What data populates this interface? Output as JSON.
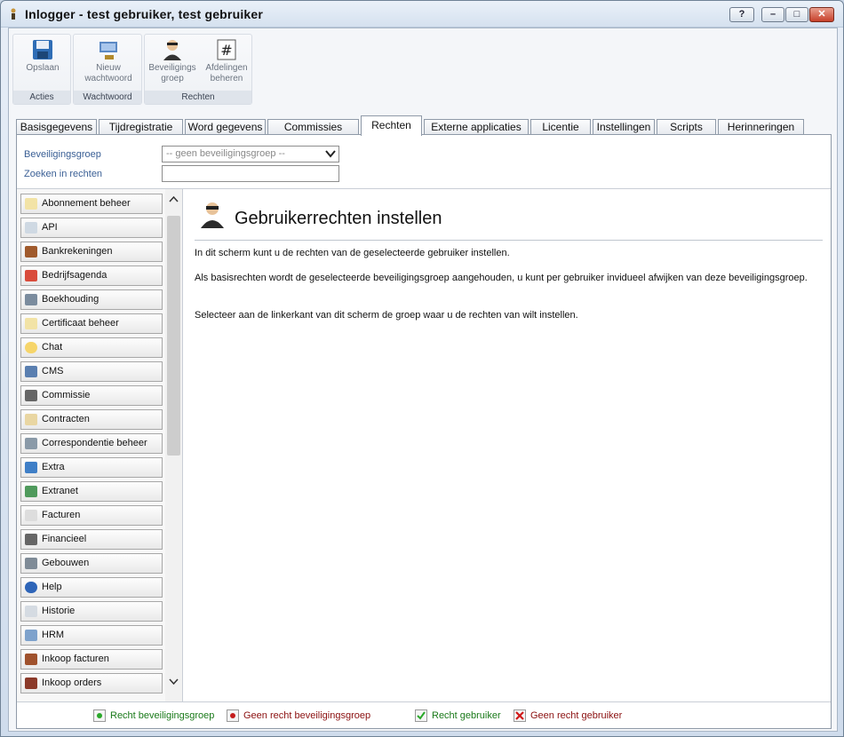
{
  "window": {
    "title": "Inlogger - test gebruiker, test gebruiker",
    "help": "?",
    "min": "–",
    "max": "□",
    "close": "✕"
  },
  "ribbon": {
    "groups": [
      {
        "label": "Acties",
        "buttons": [
          {
            "l1": "Opslaan",
            "l2": "",
            "icon": "save-icon"
          }
        ]
      },
      {
        "label": "Wachtwoord",
        "buttons": [
          {
            "l1": "Nieuw",
            "l2": "wachtwoord",
            "icon": "password-icon"
          }
        ]
      },
      {
        "label": "Rechten",
        "buttons": [
          {
            "l1": "Beveiligings",
            "l2": "groep",
            "icon": "security-group-icon"
          },
          {
            "l1": "Afdelingen",
            "l2": "beheren",
            "icon": "hash-icon"
          }
        ]
      }
    ]
  },
  "tabs": [
    "Basisgegevens",
    "Tijdregistratie",
    "Word gegevens",
    "Commissies",
    "Rechten",
    "Externe applicaties",
    "Licentie",
    "Instellingen",
    "Scripts",
    "Herinneringen"
  ],
  "active_tab": "Rechten",
  "form": {
    "group_label": "Beveiligingsgroep",
    "group_value": "-- geen beveiligingsgroep --",
    "search_label": "Zoeken in rechten",
    "search_value": ""
  },
  "modules": [
    "Abonnement beheer",
    "API",
    "Bankrekeningen",
    "Bedrijfsagenda",
    "Boekhouding",
    "Certificaat beheer",
    "Chat",
    "CMS",
    "Commissie",
    "Contracten",
    "Correspondentie beheer",
    "Extra",
    "Extranet",
    "Facturen",
    "Financieel",
    "Gebouwen",
    "Help",
    "Historie",
    "HRM",
    "Inkoop facturen",
    "Inkoop orders"
  ],
  "content": {
    "title": "Gebruikerrechten instellen",
    "p1": "In dit scherm kunt u de rechten van de geselecteerde gebruiker instellen.",
    "p2": "Als basisrechten wordt de geselecteerde beveiligingsgroep aangehouden, u kunt per gebruiker invidueel afwijken van deze beveiligingsgroep.",
    "p3": "Selecteer aan de linkerkant van dit scherm de groep waar u de rechten van wilt instellen."
  },
  "legend": {
    "a": "Recht beveiligingsgroep",
    "b": "Geen recht beveiligingsgroep",
    "c": "Recht gebruiker",
    "d": "Geen recht gebruiker",
    "colors": {
      "a": "#1a7a1a",
      "b": "#8b1010",
      "c": "#1a7a1a",
      "d": "#8b1010"
    }
  }
}
